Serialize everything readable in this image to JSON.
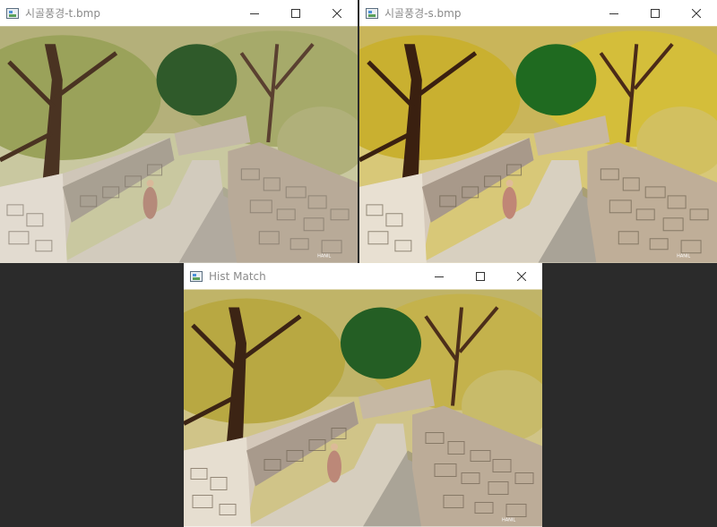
{
  "windows": {
    "target": {
      "title": "시골풍경-t.bmp"
    },
    "source": {
      "title": "시골풍경-s.bmp"
    },
    "result": {
      "title": "Hist Match"
    }
  },
  "photo": {
    "signature": "HANIL"
  },
  "palette": {
    "desktop": "#2b2b2b",
    "target_foliage": "#9aa25a",
    "source_foliage": "#c9b030",
    "result_foliage": "#b8a842"
  }
}
